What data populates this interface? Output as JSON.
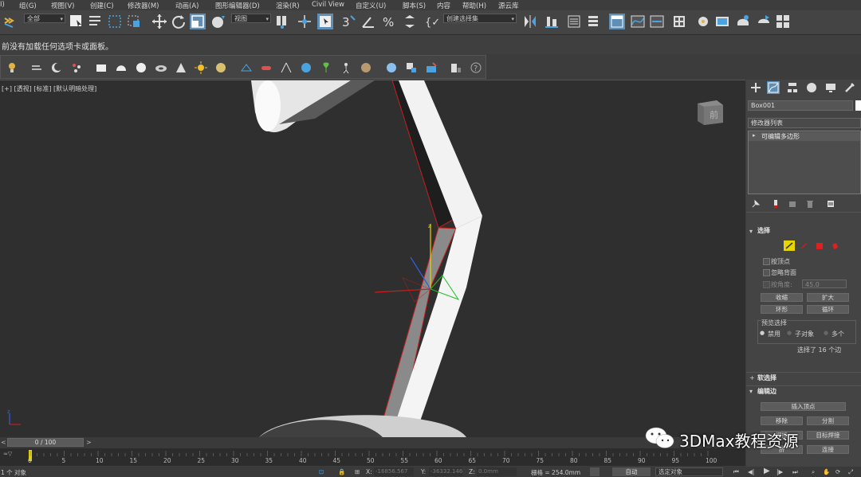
{
  "menu": [
    "I)",
    "组(G)",
    "视图(V)",
    "创建(C)",
    "修改器(M)",
    "动画(A)",
    "图形编辑器(D)",
    "渲染(R)",
    "Civil View",
    "自定义(U)",
    "脚本(S)",
    "内容",
    "帮助(H)",
    "源云库"
  ],
  "toolbar": {
    "selection_filter": "全部",
    "ref_coord": "视图",
    "named_selection": "创建选择集"
  },
  "message": "前没有加载任何选项卡或面板。",
  "viewport": {
    "label": "[+] [透视] [标准] [默认明暗处理]",
    "viewcube_label": "前"
  },
  "panel": {
    "object_name": "Box001",
    "modifier_list": "修改器列表",
    "stack_item": "可编辑多边形",
    "selection_rollout": "选择",
    "by_vertex": "按顶点",
    "ignore_backface": "忽略背面",
    "angle_label": "按角度:",
    "angle_value": "45.0",
    "shrink": "收缩",
    "grow": "扩大",
    "ring": "环形",
    "loop": "循环",
    "preview_selection": "预览选择",
    "preview_off": "禁用",
    "preview_subobj": "子对象",
    "preview_multi": "多个",
    "selected_info": "选择了 16 个边",
    "soft_selection": "软选择",
    "edit_edges": "编辑边",
    "insert_vertex": "插入顶点",
    "remove": "移除",
    "split": "分割",
    "weld": "焊接",
    "target_weld": "目标焊接",
    "bridge": "挤",
    "connect": "连接"
  },
  "timeline": {
    "frame": "0 / 100",
    "ticks": [
      "0",
      "5",
      "10",
      "15",
      "20",
      "25",
      "30",
      "35",
      "40",
      "45",
      "50",
      "55",
      "60",
      "65",
      "70",
      "75",
      "80",
      "85",
      "90",
      "95",
      "100"
    ]
  },
  "status": {
    "objects": "1 个 对象",
    "x_label": "X:",
    "x_value": "-16856.567",
    "y_label": "Y:",
    "y_value": "-36332.146",
    "z_label": "Z:",
    "z_value": "0.0mm",
    "grid": "栅格 = 254.0mm",
    "auto": "自动",
    "selected_objects": "选定对象"
  },
  "watermark": "3DMax教程资源",
  "colors": {
    "accent_blue": "#4aa3df",
    "edge_red": "#c81e1e",
    "selection_yellow": "#e8d400"
  }
}
